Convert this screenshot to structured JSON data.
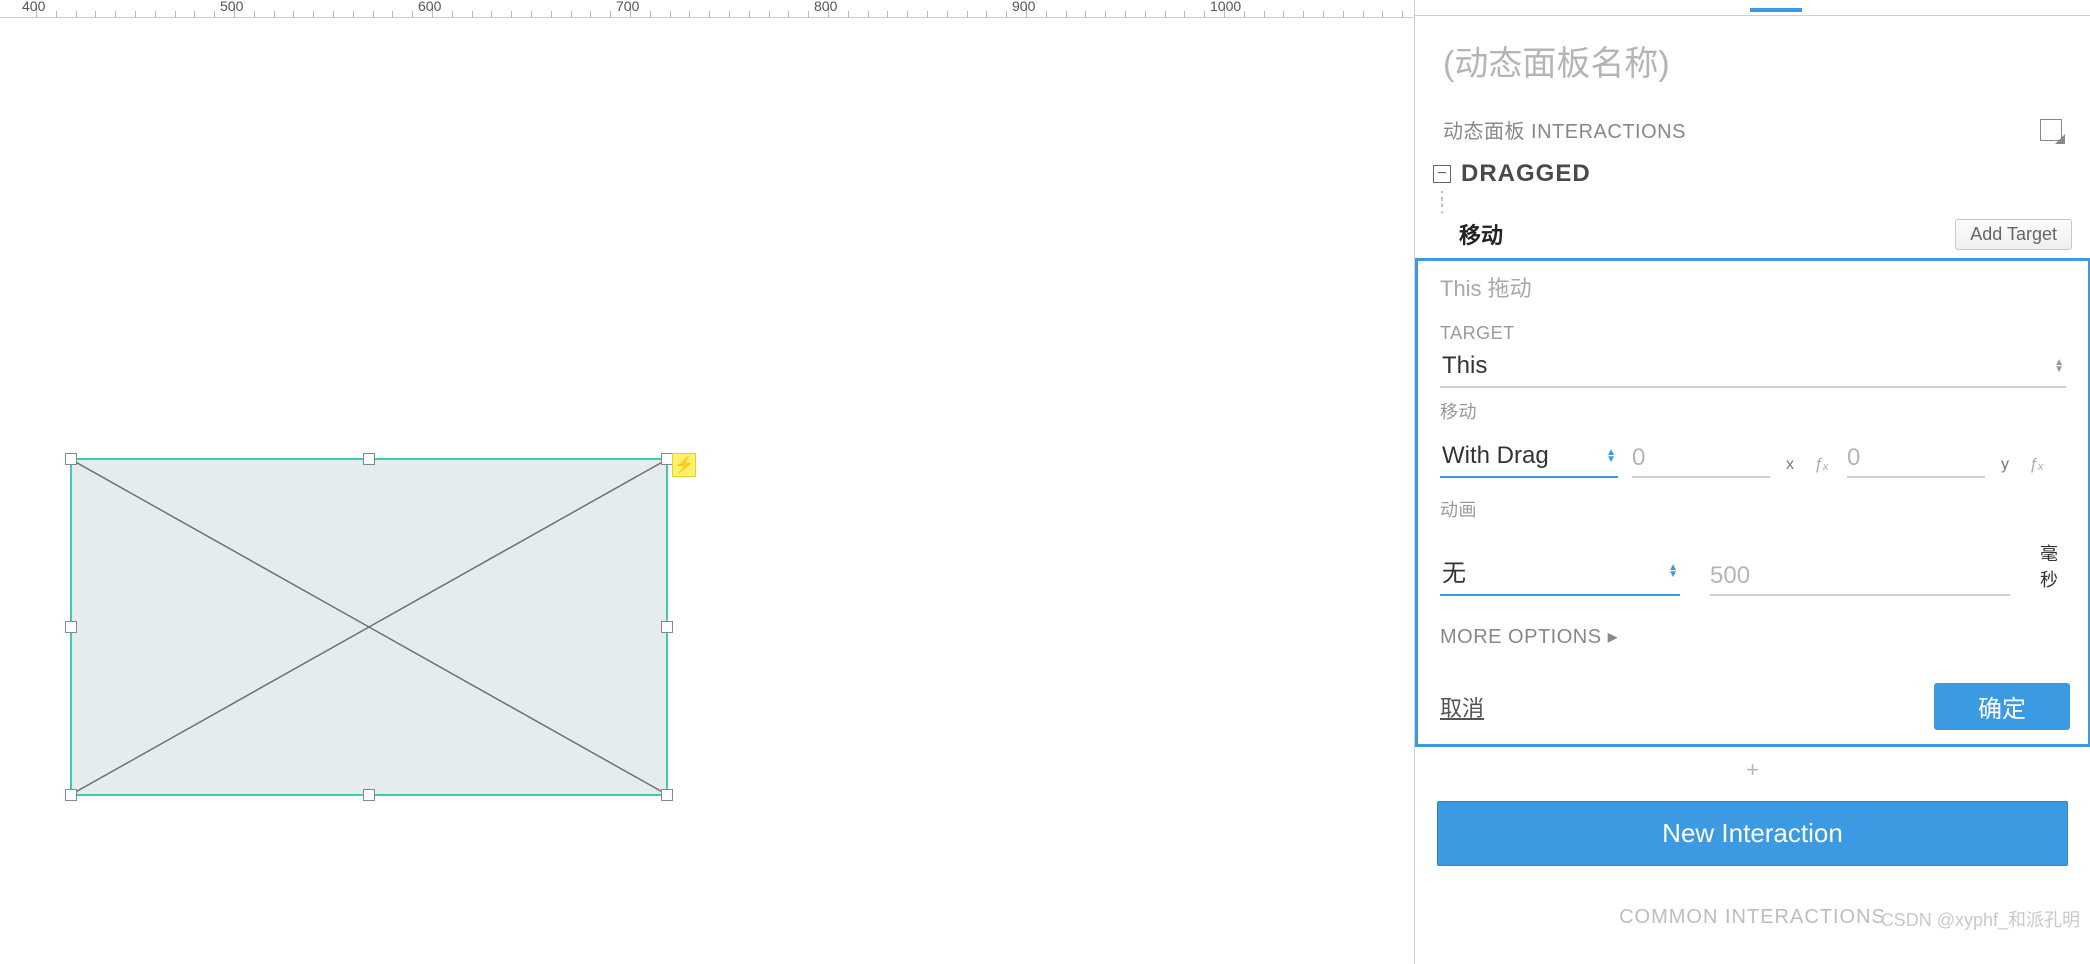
{
  "ruler": {
    "start": 400,
    "end": 1000,
    "step": 100
  },
  "canvas": {
    "element_type": "动态面板",
    "lightning_icon": "⚡"
  },
  "panel": {
    "title_placeholder": "(动态面板名称)",
    "section_label": "动态面板 INTERACTIONS",
    "event": {
      "name": "DRAGGED",
      "action": "移动",
      "add_target": "Add Target",
      "summary": "This 拖动"
    },
    "fields": {
      "target_label": "TARGET",
      "target_value": "This",
      "move_label": "移动",
      "move_mode": "With Drag",
      "x_placeholder": "0",
      "x_label": "x",
      "y_placeholder": "0",
      "y_label": "y",
      "fx": "ƒₓ",
      "anim_label": "动画",
      "anim_value": "无",
      "duration_placeholder": "500",
      "ms": "毫秒",
      "more_options": "MORE OPTIONS ▸"
    },
    "buttons": {
      "cancel": "取消",
      "ok": "确定",
      "plus": "+",
      "new_interaction": "New Interaction",
      "common": "COMMON INTERACTIONS"
    }
  },
  "watermark": "CSDN @xyphf_和派孔明"
}
